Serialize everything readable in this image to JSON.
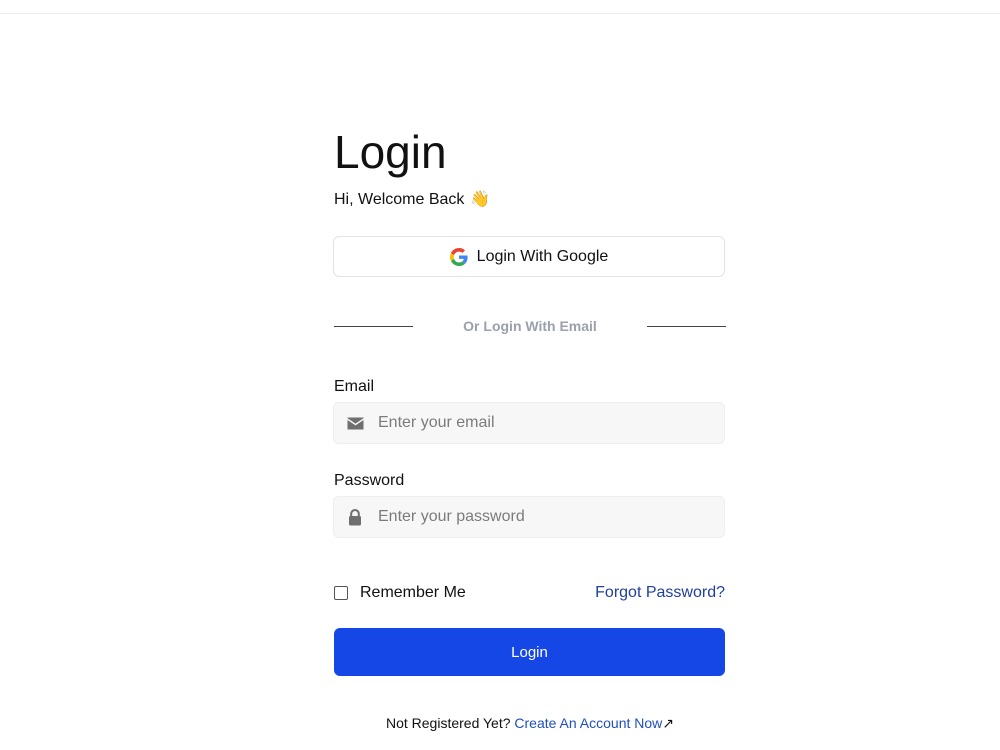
{
  "header": {
    "title": "Login",
    "subtitle": "Hi, Welcome Back",
    "subtitle_emoji": "👋"
  },
  "google": {
    "label": "Login With Google",
    "icon": "google-g-icon",
    "colors": {
      "blue": "#4285F4",
      "red": "#EA4335",
      "yellow": "#FBBC05",
      "green": "#34A853"
    }
  },
  "divider": {
    "text": "Or Login With Email"
  },
  "email": {
    "label": "Email",
    "placeholder": "Enter your email",
    "value": "",
    "icon": "envelope-icon"
  },
  "password": {
    "label": "Password",
    "placeholder": "Enter your password",
    "value": "",
    "icon": "lock-icon"
  },
  "remember": {
    "label": "Remember Me",
    "checked": false
  },
  "forgot": {
    "label": "Forgot Password?"
  },
  "submit": {
    "label": "Login"
  },
  "footer": {
    "prompt": "Not Registered Yet?",
    "link": "Create An Account Now",
    "link_arrow": "↗"
  },
  "colors": {
    "primary": "#1447e6",
    "link": "#1f3f9c",
    "muted": "#9aa0ae",
    "input_bg": "#f7f7f7"
  }
}
